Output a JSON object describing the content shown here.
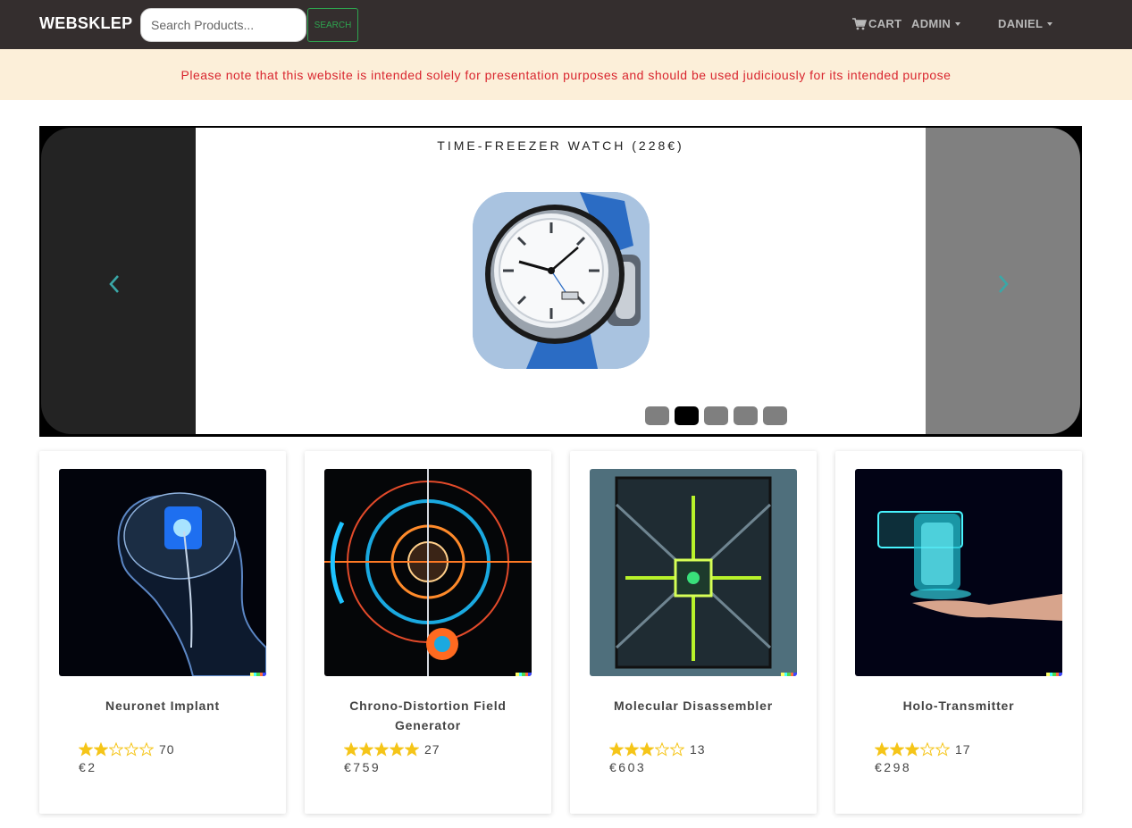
{
  "navbar": {
    "brand": "WEBSKLEP",
    "search_placeholder": "Search Products...",
    "search_button": "SEARCH",
    "cart_label": "CART",
    "admin_label": "ADMIN",
    "user_label": "DANIEL"
  },
  "notice": {
    "text": "Please note that this website is intended solely for presentation purposes and should be used judiciously for its intended purpose"
  },
  "carousel": {
    "caption": "TIME-FREEZER WATCH (228€)",
    "indicator_count": 5,
    "active_indicator": 2
  },
  "products": [
    {
      "name": "Neuronet Implant",
      "rating": 2,
      "reviews": "70",
      "price": "€2"
    },
    {
      "name": "Chrono-Distortion Field Generator",
      "rating": 5,
      "reviews": "27",
      "price": "€759"
    },
    {
      "name": "Molecular Disassembler",
      "rating": 3,
      "reviews": "13",
      "price": "€603"
    },
    {
      "name": "Holo-Transmitter",
      "rating": 3,
      "reviews": "17",
      "price": "€298"
    }
  ],
  "colors": {
    "navbar_bg": "#342e2e",
    "notice_bg": "#fcefd9",
    "notice_text": "#d9262f",
    "search_accent": "#2ea44f",
    "star": "#f5c518",
    "arrow": "#3aa7a7"
  }
}
